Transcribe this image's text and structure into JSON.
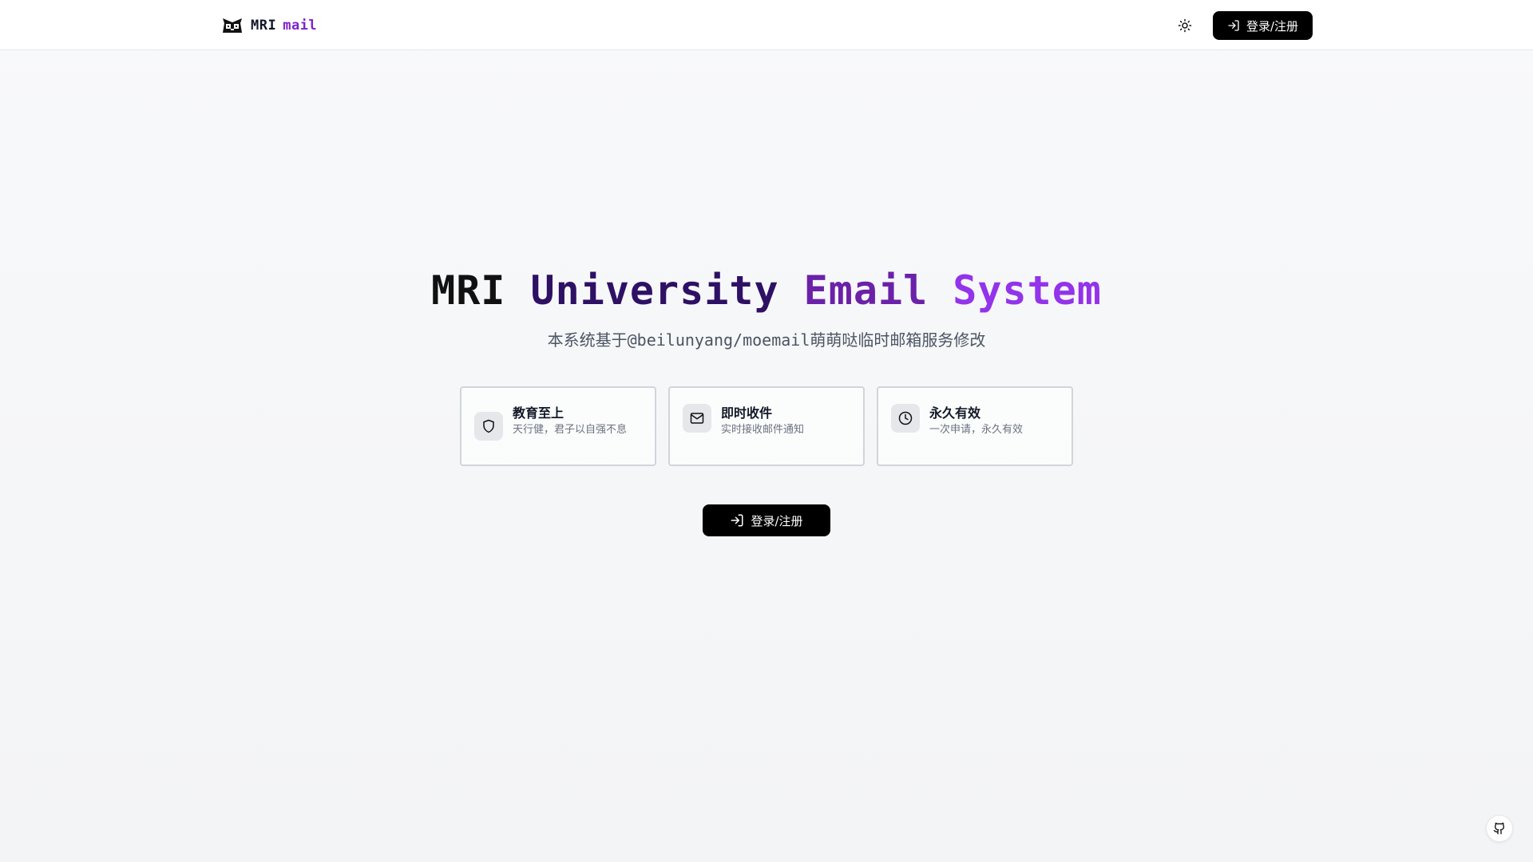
{
  "header": {
    "logo": {
      "part1": "MRI",
      "part2": "mail",
      "icon": "owl-logo-icon"
    },
    "theme_toggle_icon": "sun-icon",
    "login_label": "登录/注册",
    "login_icon": "login-arrow-icon"
  },
  "hero": {
    "title_words": [
      "MRI",
      "University",
      "Email",
      "System"
    ],
    "subtitle": "本系统基于@beilunyang/moemail萌萌哒临时邮箱服务修改"
  },
  "features": [
    {
      "icon": "shield-icon",
      "title": "教育至上",
      "desc": "天行健，君子以自强不息"
    },
    {
      "icon": "mail-icon",
      "title": "即时收件",
      "desc": "实时接收邮件通知"
    },
    {
      "icon": "clock-icon",
      "title": "永久有效",
      "desc": "一次申请，永久有效"
    }
  ],
  "main_login_label": "登录/注册",
  "footer": {
    "github_icon": "github-icon"
  },
  "colors": {
    "accent": "#7e22ce",
    "button": "#000000",
    "background": "#f8f9fa"
  }
}
